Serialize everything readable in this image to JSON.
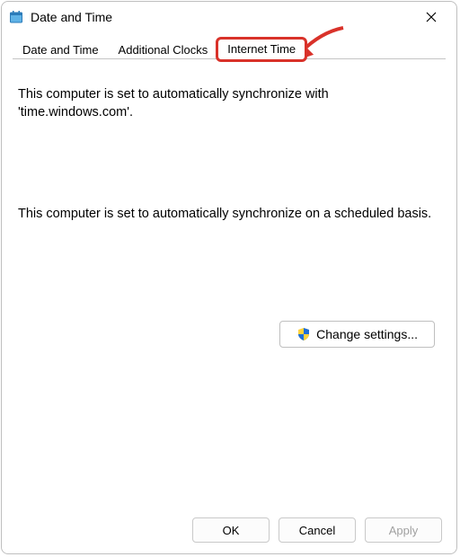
{
  "window_title": "Date and Time",
  "icons": {
    "title": "calendar-icon",
    "close": "close-icon",
    "shield": "shield-icon"
  },
  "tabs": [
    {
      "label": "Date and Time",
      "selected": false,
      "highlighted": false
    },
    {
      "label": "Additional Clocks",
      "selected": false,
      "highlighted": false
    },
    {
      "label": "Internet Time",
      "selected": true,
      "highlighted": true
    }
  ],
  "body": {
    "sync_message": "This computer is set to automatically synchronize with 'time.windows.com'.",
    "schedule_message": "This computer is set to automatically synchronize on a scheduled basis.",
    "change_settings_label": "Change settings..."
  },
  "footer": {
    "ok": "OK",
    "cancel": "Cancel",
    "apply": "Apply"
  },
  "annotation": {
    "arrow_present": true,
    "highlight_color": "#d9322a"
  }
}
